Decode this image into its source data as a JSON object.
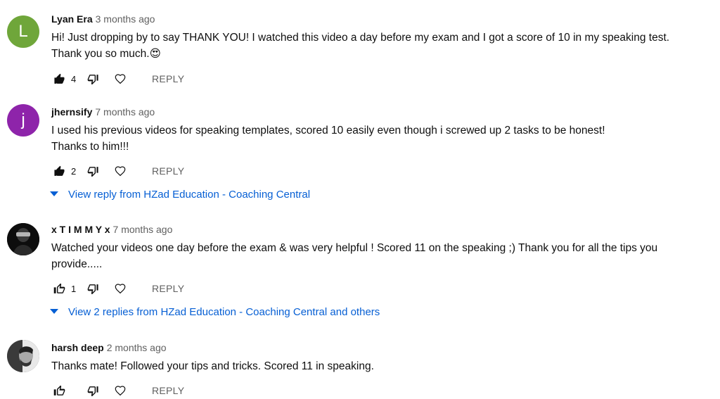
{
  "comments": [
    {
      "avatar_letter": "L",
      "avatar_color": "#6fa63a",
      "author": "Lyan Era",
      "time": "3 months ago",
      "lines": [
        "Hi! Just dropping by to say THANK YOU! I watched this video a day before my exam and I got a score of 10 in my speaking test.",
        "Thank you so much.😍"
      ],
      "likes": "4",
      "liked": true,
      "reply_label": "REPLY"
    },
    {
      "avatar_letter": "j",
      "avatar_color": "#8e24aa",
      "author": "jhernsify",
      "time": "7 months ago",
      "lines": [
        "I used his previous videos for speaking templates, scored 10 easily even though i screwed up 2 tasks to be honest!",
        "Thanks to him!!!"
      ],
      "likes": "2",
      "liked": true,
      "reply_label": "REPLY",
      "view_replies": "View reply from HZad Education - Coaching Central"
    },
    {
      "avatar_letter": "",
      "avatar_color": "#111111",
      "author": "x T I M M Y x",
      "time": "7 months ago",
      "lines": [
        "Watched your videos one day before the exam & was very helpful ! Scored 11 on the speaking ;) Thank you for all the tips you",
        "provide....."
      ],
      "likes": "1",
      "liked": false,
      "reply_label": "REPLY",
      "view_replies": "View 2 replies from HZad Education - Coaching Central and others"
    },
    {
      "avatar_letter": "",
      "avatar_color": "#2b2b2b",
      "author": "harsh deep",
      "time": "2 months ago",
      "lines": [
        "Thanks mate! Followed your tips and tricks. Scored 11 in speaking."
      ],
      "likes": "",
      "liked": false,
      "reply_label": "REPLY"
    }
  ],
  "colors": {
    "link": "#065fd4",
    "secondary_text": "#606060"
  }
}
